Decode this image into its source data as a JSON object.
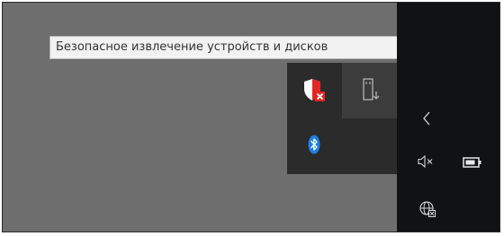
{
  "tooltip": {
    "text": "Безопасное извлечение устройств и дисков"
  },
  "flyout": {
    "icons": [
      "security-warning-icon",
      "usb-safely-remove-icon",
      "bluetooth-icon"
    ]
  },
  "taskbar": {
    "icons": [
      "chevron-left-icon",
      "volume-muted-icon",
      "battery-icon",
      "network-globe-icon"
    ]
  },
  "colors": {
    "desktop": "#6e6e6e",
    "taskbar": "#111214",
    "flyout": "#2b2b2b",
    "flyout_selected": "#3c3c3c",
    "bluetooth": "#1f7fe0",
    "alert": "#e22626"
  }
}
